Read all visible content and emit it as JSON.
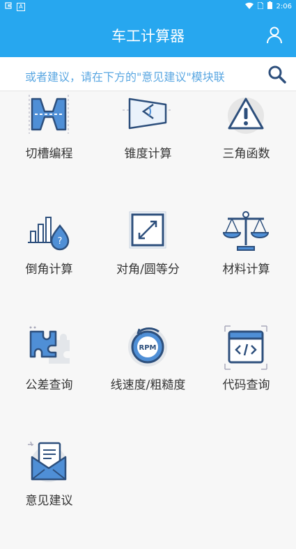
{
  "status": {
    "time": "2:06"
  },
  "header": {
    "title": "车工计算器"
  },
  "search": {
    "marquee": "或者建议，请在下方的\"意见建议\"模块联"
  },
  "tiles": [
    {
      "label": "切槽编程",
      "icon": "groove-icon"
    },
    {
      "label": "锥度计算",
      "icon": "taper-icon"
    },
    {
      "label": "三角函数",
      "icon": "warning-icon"
    },
    {
      "label": "倒角计算",
      "icon": "chamfer-chart-icon"
    },
    {
      "label": "对角/圆等分",
      "icon": "diagonal-icon"
    },
    {
      "label": "材料计算",
      "icon": "scale-icon"
    },
    {
      "label": "公差查询",
      "icon": "puzzle-icon"
    },
    {
      "label": "线速度/粗糙度",
      "icon": "rpm-icon"
    },
    {
      "label": "代码查询",
      "icon": "code-icon"
    },
    {
      "label": "意见建议",
      "icon": "mail-icon"
    }
  ],
  "colors": {
    "primary": "#27a7ef",
    "icon_dark": "#2d4f7c",
    "icon_fill": "#4f8fd6"
  }
}
